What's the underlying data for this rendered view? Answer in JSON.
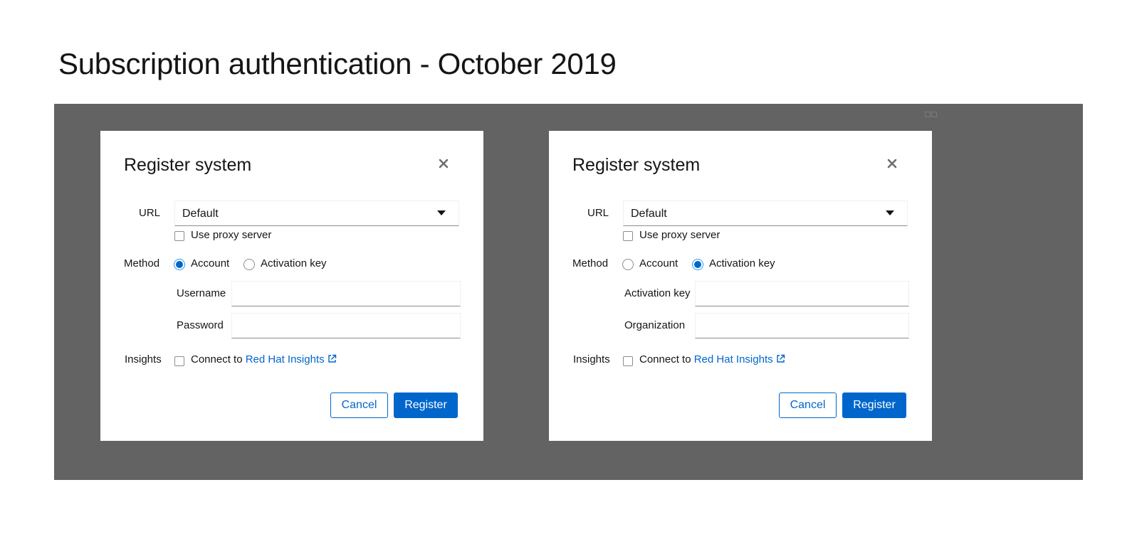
{
  "page": {
    "title": "Subscription authentication - October 2019"
  },
  "colors": {
    "backdrop": "#636363",
    "primary": "#0066cc",
    "radio_border_checked": "#2b9af3",
    "input_border": "#8a8d90"
  },
  "modals": [
    {
      "title": "Register system",
      "close_icon": "close-icon",
      "url_label": "URL",
      "url_value": "Default",
      "proxy_label": "Use proxy server",
      "proxy_checked": false,
      "method_label": "Method",
      "method_options": [
        "Account",
        "Activation key"
      ],
      "method_selected": "Account",
      "field1_label": "Username",
      "field1_value": "",
      "field2_label": "Password",
      "field2_value": "",
      "insights_label": "Insights",
      "insights_prefix": "Connect to",
      "insights_link": "Red Hat Insights",
      "insights_icon": "external-link-icon",
      "insights_checked": false,
      "cancel_label": "Cancel",
      "register_label": "Register"
    },
    {
      "title": "Register system",
      "close_icon": "close-icon",
      "url_label": "URL",
      "url_value": "Default",
      "proxy_label": "Use proxy server",
      "proxy_checked": false,
      "method_label": "Method",
      "method_options": [
        "Account",
        "Activation key"
      ],
      "method_selected": "Activation key",
      "field1_label": "Activation key",
      "field1_value": "",
      "field2_label": "Organization",
      "field2_value": "",
      "insights_label": "Insights",
      "insights_prefix": "Connect to",
      "insights_link": "Red Hat Insights",
      "insights_icon": "external-link-icon",
      "insights_checked": false,
      "cancel_label": "Cancel",
      "register_label": "Register"
    }
  ]
}
